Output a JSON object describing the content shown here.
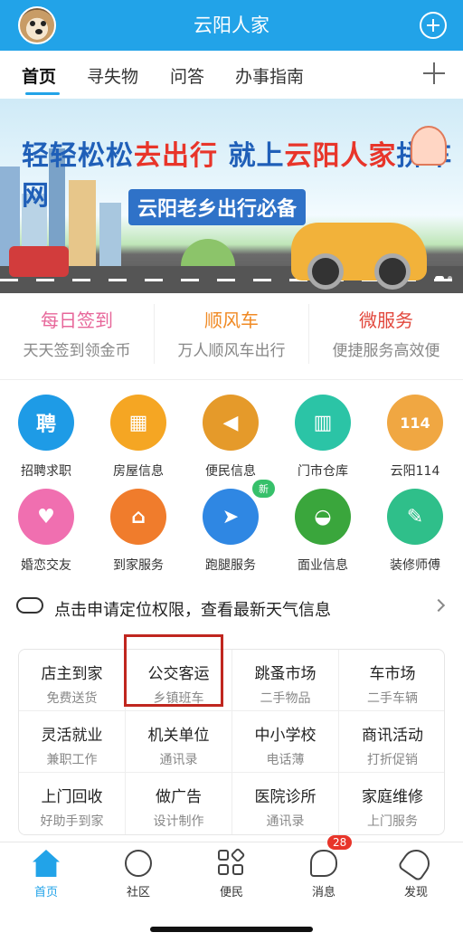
{
  "header": {
    "title": "云阳人家"
  },
  "tabs": [
    {
      "label": "首页",
      "active": true
    },
    {
      "label": "寻失物"
    },
    {
      "label": "问答"
    },
    {
      "label": "办事指南"
    }
  ],
  "banner": {
    "headline_part1": "轻轻松松",
    "headline_hl1": "去出行",
    "headline_part2": "  就上",
    "headline_hl2": "云阳人家",
    "headline_part3": "拼车网",
    "subline": "云阳老乡出行必备"
  },
  "promos": [
    {
      "title": "每日签到",
      "subtitle": "天天签到领金币",
      "color": "#e7679a"
    },
    {
      "title": "顺风车",
      "subtitle": "万人顺风车出行",
      "color": "#f08a24"
    },
    {
      "title": "微服务",
      "subtitle": "便捷服务高效便",
      "color": "#e2473c"
    }
  ],
  "grid": [
    {
      "label": "招聘求职",
      "icon": "recruit-icon",
      "glyph": "聘",
      "color": "#1e9be6"
    },
    {
      "label": "房屋信息",
      "icon": "building-icon",
      "glyph": "▦",
      "color": "#f5a623"
    },
    {
      "label": "便民信息",
      "icon": "megaphone-icon",
      "glyph": "📢",
      "color": "#e59a2a"
    },
    {
      "label": "门市仓库",
      "icon": "store-icon",
      "glyph": "▥",
      "color": "#2bc4a6"
    },
    {
      "label": "云阳114",
      "icon": "phone-114-icon",
      "glyph": "114",
      "color": "#f0a742"
    },
    {
      "label": "婚恋交友",
      "icon": "hearts-icon",
      "glyph": "♥",
      "color": "#f06fb0"
    },
    {
      "label": "到家服务",
      "icon": "home-service-icon",
      "glyph": "⌂",
      "color": "#f07c2c"
    },
    {
      "label": "跑腿服务",
      "icon": "delivery-scooter-icon",
      "glyph": "🛵",
      "color": "#2f87e3",
      "badge": "新"
    },
    {
      "label": "面业信息",
      "icon": "noodle-bowl-icon",
      "glyph": "◒",
      "color": "#3aa63c"
    },
    {
      "label": "装修师傅",
      "icon": "paint-roller-icon",
      "glyph": "✎",
      "color": "#2fbf8a"
    }
  ],
  "weather": {
    "text": "点击申请定位权限，查看最新天气信息"
  },
  "services": [
    {
      "title": "店主到家",
      "subtitle": "免费送货"
    },
    {
      "title": "公交客运",
      "subtitle": "乡镇班车"
    },
    {
      "title": "跳蚤市场",
      "subtitle": "二手物品"
    },
    {
      "title": "车市场",
      "subtitle": "二手车辆"
    },
    {
      "title": "灵活就业",
      "subtitle": "兼职工作"
    },
    {
      "title": "机关单位",
      "subtitle": "通讯录"
    },
    {
      "title": "中小学校",
      "subtitle": "电话薄"
    },
    {
      "title": "商讯活动",
      "subtitle": "打折促销"
    },
    {
      "title": "上门回收",
      "subtitle": "好助手到家"
    },
    {
      "title": "做广告",
      "subtitle": "设计制作"
    },
    {
      "title": "医院诊所",
      "subtitle": "通讯录"
    },
    {
      "title": "家庭维修",
      "subtitle": "上门服务"
    }
  ],
  "bottom_nav": [
    {
      "label": "首页",
      "icon": "home-icon",
      "active": true
    },
    {
      "label": "社区",
      "icon": "community-icon"
    },
    {
      "label": "便民",
      "icon": "grid-apps-icon"
    },
    {
      "label": "消息",
      "icon": "message-icon",
      "badge": "28"
    },
    {
      "label": "发现",
      "icon": "rocket-icon"
    }
  ],
  "colors": {
    "brand": "#22a3e8",
    "highlight": "#c0261f"
  }
}
